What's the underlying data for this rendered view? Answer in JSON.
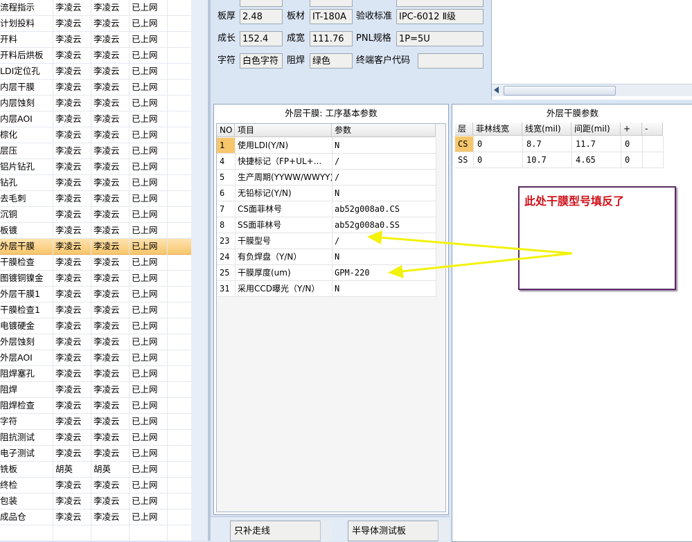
{
  "process_list": {
    "rows": [
      {
        "name": "流程指示",
        "c1": "李凌云",
        "c2": "李凌云",
        "status": "已上网"
      },
      {
        "name": "计划投料",
        "c1": "李凌云",
        "c2": "李凌云",
        "status": "已上网"
      },
      {
        "name": "开料",
        "c1": "李凌云",
        "c2": "李凌云",
        "status": "已上网"
      },
      {
        "name": "开料后烘板",
        "c1": "李凌云",
        "c2": "李凌云",
        "status": "已上网"
      },
      {
        "name": "LDI定位孔",
        "c1": "李凌云",
        "c2": "李凌云",
        "status": "已上网"
      },
      {
        "name": "内层干膜",
        "c1": "李凌云",
        "c2": "李凌云",
        "status": "已上网"
      },
      {
        "name": "内层蚀刻",
        "c1": "李凌云",
        "c2": "李凌云",
        "status": "已上网"
      },
      {
        "name": "内层AOI",
        "c1": "李凌云",
        "c2": "李凌云",
        "status": "已上网"
      },
      {
        "name": "棕化",
        "c1": "李凌云",
        "c2": "李凌云",
        "status": "已上网"
      },
      {
        "name": "层压",
        "c1": "李凌云",
        "c2": "李凌云",
        "status": "已上网"
      },
      {
        "name": "铝片钻孔",
        "c1": "李凌云",
        "c2": "李凌云",
        "status": "已上网"
      },
      {
        "name": "钻孔",
        "c1": "李凌云",
        "c2": "李凌云",
        "status": "已上网"
      },
      {
        "name": "去毛刺",
        "c1": "李凌云",
        "c2": "李凌云",
        "status": "已上网"
      },
      {
        "name": "沉铜",
        "c1": "李凌云",
        "c2": "李凌云",
        "status": "已上网"
      },
      {
        "name": "板镀",
        "c1": "李凌云",
        "c2": "李凌云",
        "status": "已上网"
      },
      {
        "name": "外层干膜",
        "c1": "李凌云",
        "c2": "李凌云",
        "status": "已上网",
        "selected": true
      },
      {
        "name": "干膜检查",
        "c1": "李凌云",
        "c2": "李凌云",
        "status": "已上网"
      },
      {
        "name": "图镀铜镍金",
        "c1": "李凌云",
        "c2": "李凌云",
        "status": "已上网"
      },
      {
        "name": "外层干膜1",
        "c1": "李凌云",
        "c2": "李凌云",
        "status": "已上网"
      },
      {
        "name": "干膜检查1",
        "c1": "李凌云",
        "c2": "李凌云",
        "status": "已上网"
      },
      {
        "name": "电镀硬金",
        "c1": "李凌云",
        "c2": "李凌云",
        "status": "已上网"
      },
      {
        "name": "外层蚀刻",
        "c1": "李凌云",
        "c2": "李凌云",
        "status": "已上网"
      },
      {
        "name": "外层AOI",
        "c1": "李凌云",
        "c2": "李凌云",
        "status": "已上网"
      },
      {
        "name": "阻焊塞孔",
        "c1": "李凌云",
        "c2": "李凌云",
        "status": "已上网"
      },
      {
        "name": "阻焊",
        "c1": "李凌云",
        "c2": "李凌云",
        "status": "已上网"
      },
      {
        "name": "阻焊检查",
        "c1": "李凌云",
        "c2": "李凌云",
        "status": "已上网"
      },
      {
        "name": "字符",
        "c1": "李凌云",
        "c2": "李凌云",
        "status": "已上网"
      },
      {
        "name": "阻抗测试",
        "c1": "李凌云",
        "c2": "李凌云",
        "status": "已上网"
      },
      {
        "name": "电子测试",
        "c1": "李凌云",
        "c2": "李凌云",
        "status": "已上网"
      },
      {
        "name": "铣板",
        "c1": "胡英",
        "c2": "胡英",
        "status": "已上网"
      },
      {
        "name": "终检",
        "c1": "李凌云",
        "c2": "李凌云",
        "status": "已上网"
      },
      {
        "name": "包装",
        "c1": "李凌云",
        "c2": "李凌云",
        "status": "已上网"
      },
      {
        "name": "成品仓",
        "c1": "李凌云",
        "c2": "李凌云",
        "status": "已上网"
      }
    ]
  },
  "info": {
    "thickness_label": "板厚",
    "thickness": "2.48",
    "material_label": "板材",
    "material": "IT-180A",
    "standard_label": "验收标准",
    "standard": "IPC-6012 Ⅱ级",
    "length_label": "成长",
    "length": "152.4",
    "width_label": "成宽",
    "width": "111.76",
    "pnl_label": "PNL规格",
    "pnl": "1P=5U",
    "char_label": "字符",
    "char": "白色字符",
    "mask_label": "阻焊",
    "mask": "绿色",
    "customer_code_label": "终端客户代码",
    "customer_code": ""
  },
  "params_panel": {
    "title": "外层干膜: 工序基本参数",
    "headers": {
      "no": "NO",
      "item": "项目",
      "param": "参数"
    },
    "rows": [
      {
        "no": "1",
        "item": "使用LDI(Y/N)",
        "param": "N"
      },
      {
        "no": "4",
        "item": "快捷标记（FP+UL+...",
        "param": "/"
      },
      {
        "no": "5",
        "item": "生产周期(YYWW/WWYY)",
        "param": "/"
      },
      {
        "no": "6",
        "item": "无铅标记(Y/N)",
        "param": "N"
      },
      {
        "no": "7",
        "item": "CS面菲林号",
        "param": "ab52g008a0.CS"
      },
      {
        "no": "8",
        "item": "SS面菲林号",
        "param": "ab52g008a0.SS"
      },
      {
        "no": "23",
        "item": "干膜型号",
        "param": "/"
      },
      {
        "no": "24",
        "item": "有负焊盘（Y/N）",
        "param": "N"
      },
      {
        "no": "25",
        "item": "干膜厚度(um)",
        "param": "GPM-220"
      },
      {
        "no": "31",
        "item": "采用CCD曝光（Y/N）",
        "param": "N"
      }
    ]
  },
  "film_panel": {
    "title": "外层干膜参数",
    "headers": {
      "layer": "层",
      "film_width": "菲林线宽",
      "line_width": "线宽(mil)",
      "spacing": "间距(mil)",
      "plus": "+",
      "minus": "-"
    },
    "rows": [
      {
        "layer": "CS",
        "film_width": "0",
        "line_width": "8.7",
        "spacing": "11.7",
        "plus": "0",
        "minus": ""
      },
      {
        "layer": "SS",
        "film_width": "0",
        "line_width": "10.7",
        "spacing": "4.65",
        "plus": "0",
        "minus": ""
      }
    ]
  },
  "callout": {
    "text": "此处干膜型号填反了",
    "arrow_color": "#f2f20a",
    "text_color": "#d0101a"
  },
  "bottom": {
    "field1": "只补走线",
    "field2": "半导体测试板"
  },
  "colors": {
    "selected_row": "#f7c66c",
    "panel_bg": "#dbe6f4"
  }
}
